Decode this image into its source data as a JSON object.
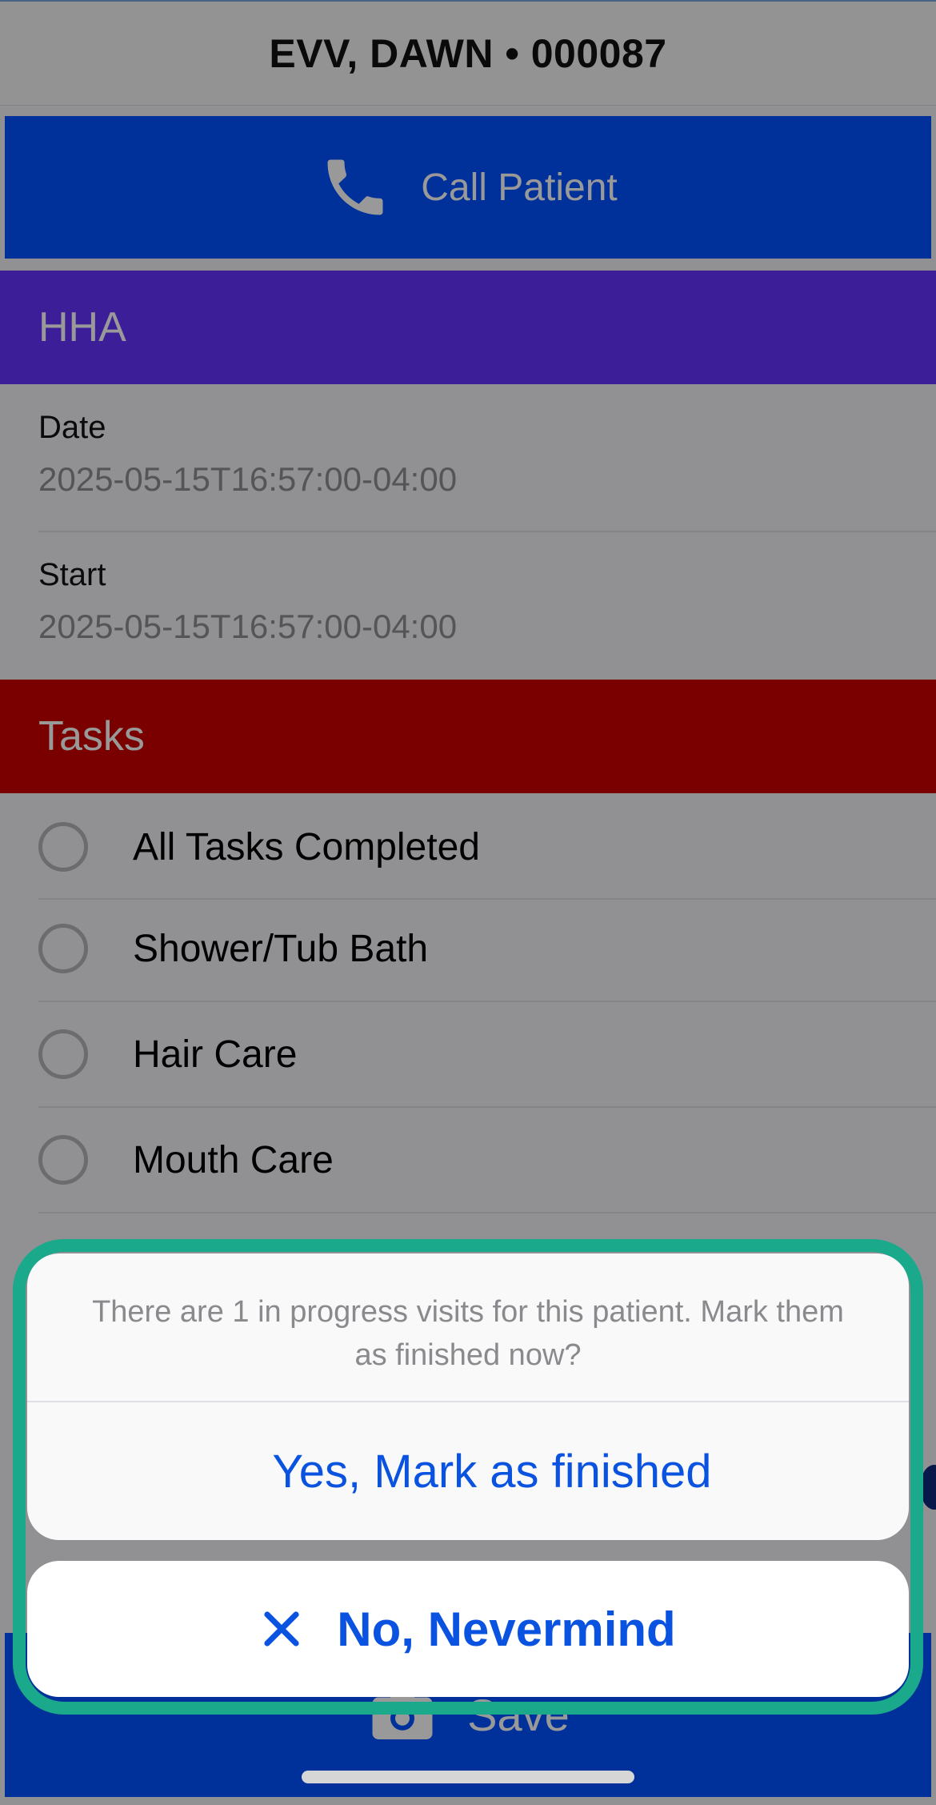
{
  "header": {
    "title": "EVV, DAWN • 000087"
  },
  "call_button": {
    "label": "Call Patient",
    "icon": "phone-icon",
    "color": "#0050ff"
  },
  "hha_section": {
    "title": "HHA",
    "color": "#6633ff",
    "fields": [
      {
        "label": "Date",
        "value": "2025-05-15T16:57:00-04:00"
      },
      {
        "label": "Start",
        "value": "2025-05-15T16:57:00-04:00"
      }
    ]
  },
  "tasks_section": {
    "title": "Tasks",
    "color": "#cc0000",
    "items": [
      {
        "label": "All Tasks Completed",
        "checked": false
      },
      {
        "label": "Shower/Tub Bath",
        "checked": false
      },
      {
        "label": "Hair Care",
        "checked": false
      },
      {
        "label": "Mouth Care",
        "checked": false
      }
    ]
  },
  "save_button": {
    "label": "Save",
    "icon": "camera-icon"
  },
  "action_sheet": {
    "message": "There are 1 in progress visits for this patient. Mark them as finished now?",
    "confirm_label": "Yes, Mark as finished",
    "cancel_label": "No, Nevermind",
    "cancel_icon": "close-icon",
    "accent_color": "#0a53e0",
    "highlight_color": "#1aa98a"
  }
}
